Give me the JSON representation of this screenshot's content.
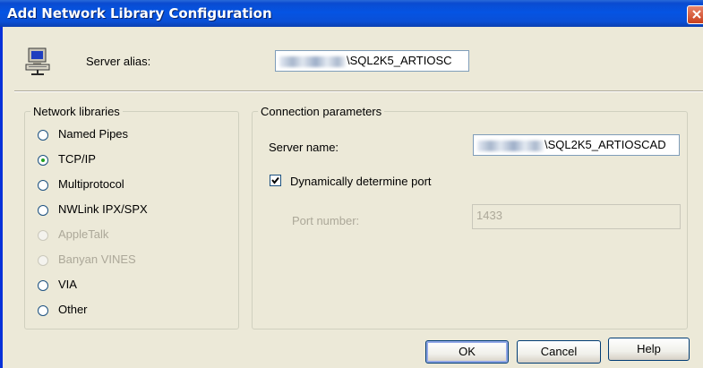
{
  "window": {
    "title": "Add Network Library Configuration"
  },
  "alias": {
    "label": "Server alias:",
    "value_suffix": "\\SQL2K5_ARTIOSC"
  },
  "network_libraries": {
    "legend": "Network libraries",
    "options": [
      {
        "label": "Named Pipes",
        "selected": false,
        "enabled": true
      },
      {
        "label": "TCP/IP",
        "selected": true,
        "enabled": true
      },
      {
        "label": "Multiprotocol",
        "selected": false,
        "enabled": true
      },
      {
        "label": "NWLink IPX/SPX",
        "selected": false,
        "enabled": true
      },
      {
        "label": "AppleTalk",
        "selected": false,
        "enabled": false
      },
      {
        "label": "Banyan VINES",
        "selected": false,
        "enabled": false
      },
      {
        "label": "VIA",
        "selected": false,
        "enabled": true
      },
      {
        "label": "Other",
        "selected": false,
        "enabled": true
      }
    ]
  },
  "connection": {
    "legend": "Connection parameters",
    "server_name_label": "Server name:",
    "server_name_suffix": "\\SQL2K5_ARTIOSCAD",
    "dynamic_port_label": "Dynamically determine port",
    "dynamic_port_checked": true,
    "port_label": "Port number:",
    "port_value": "1433"
  },
  "buttons": {
    "ok": "OK",
    "cancel": "Cancel",
    "help": "Help"
  }
}
